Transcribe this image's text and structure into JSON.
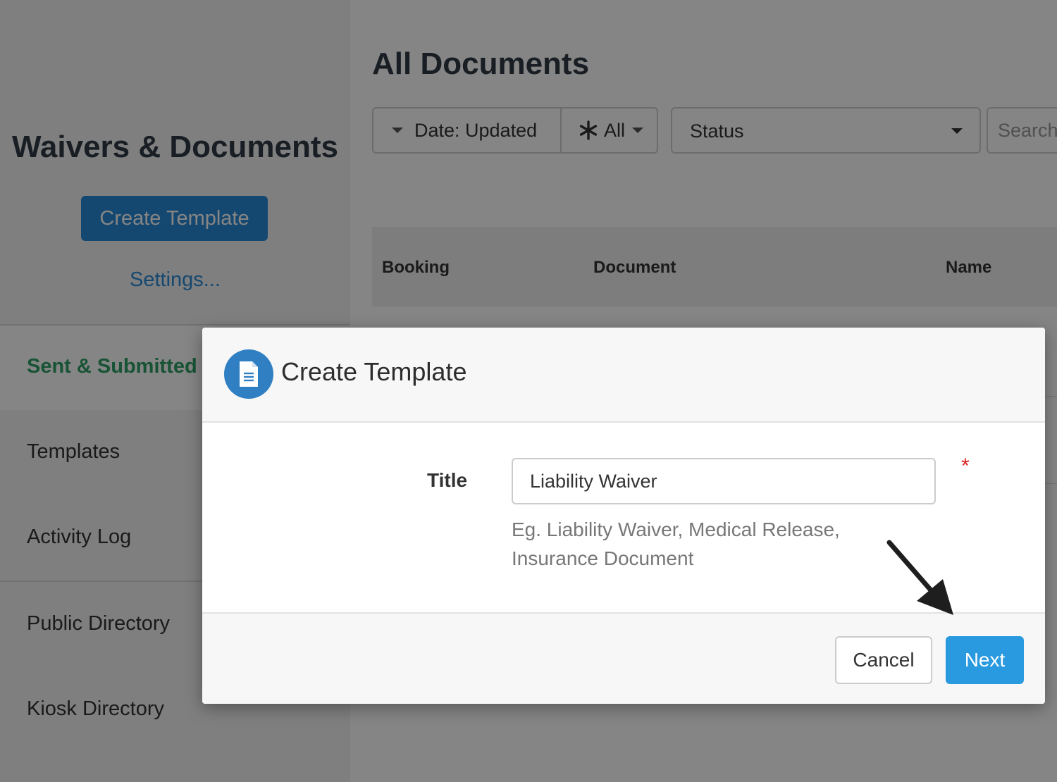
{
  "sidebar": {
    "title": "Waivers & Documents",
    "create_button": "Create Template",
    "settings_link": "Settings...",
    "nav": [
      {
        "label": "Sent & Submitted",
        "active": true
      },
      {
        "label": "Templates",
        "active": false
      },
      {
        "label": "Activity Log",
        "active": false
      },
      {
        "label": "Public Directory",
        "active": false
      },
      {
        "label": "Kiosk Directory",
        "active": false
      }
    ]
  },
  "main": {
    "title": "All Documents",
    "filters": {
      "date_label": "Date: Updated",
      "all_label": "All",
      "status_label": "Status",
      "search_placeholder": "Search"
    },
    "table": {
      "columns": [
        "Booking",
        "Document",
        "Name"
      ]
    }
  },
  "modal": {
    "title": "Create Template",
    "icon": "document-icon",
    "field_label": "Title",
    "title_value": "Liability Waiver",
    "required_marker": "*",
    "help_text": "Eg. Liability Waiver, Medical Release, Insurance Document",
    "cancel_label": "Cancel",
    "next_label": "Next"
  },
  "colors": {
    "primary": "#2a9ae0",
    "active_nav": "#2ea066",
    "required": "#e02020",
    "icon_circle": "#2f7fc2"
  }
}
